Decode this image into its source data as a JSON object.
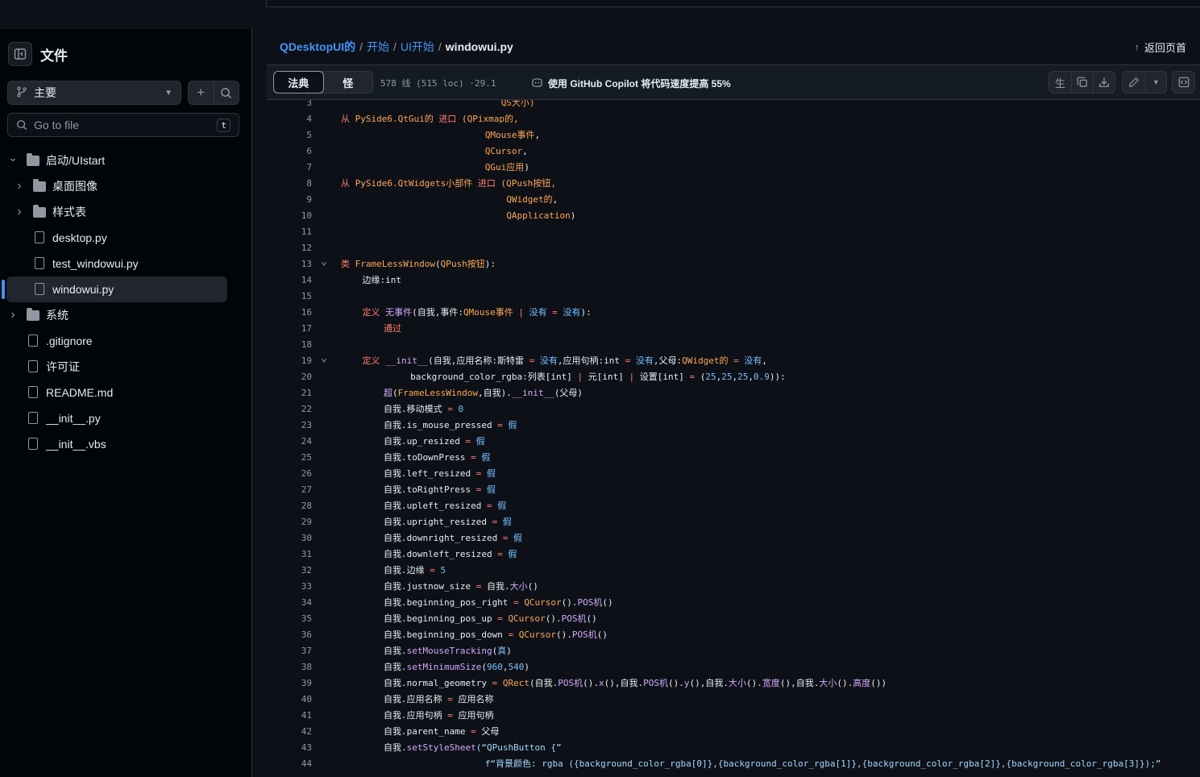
{
  "colors": {
    "link": "#4493f8",
    "keyword": "#ff7b72",
    "builtin": "#79c0ff",
    "func": "#d2a8ff",
    "class": "#ffa657",
    "string": "#a5d6ff",
    "text": "#e6edf3",
    "muted": "#9198a1"
  },
  "sidebar": {
    "title": "文件",
    "branch": "主要",
    "goto_placeholder": "Go to file",
    "goto_shortcut": "t",
    "tree": [
      {
        "name": "启动/UIstart",
        "type": "folder",
        "expanded": true,
        "depth": 0
      },
      {
        "name": "桌面图像",
        "type": "folder",
        "expanded": false,
        "depth": 1
      },
      {
        "name": "样式表",
        "type": "folder",
        "expanded": false,
        "depth": 1
      },
      {
        "name": "desktop.py",
        "type": "file",
        "depth": 1
      },
      {
        "name": "test_windowui.py",
        "type": "file",
        "depth": 1
      },
      {
        "name": "windowui.py",
        "type": "file",
        "depth": 1,
        "selected": true
      },
      {
        "name": "系统",
        "type": "folder",
        "expanded": false,
        "depth": 0
      },
      {
        "name": ".gitignore",
        "type": "file",
        "depth": 0
      },
      {
        "name": "许可证",
        "type": "file",
        "depth": 0
      },
      {
        "name": "README.md",
        "type": "file",
        "depth": 0
      },
      {
        "name": "__init__.py",
        "type": "file",
        "depth": 0
      },
      {
        "name": "__init__.vbs",
        "type": "file",
        "depth": 0
      }
    ]
  },
  "breadcrumb": {
    "links": [
      "QDesktopUI的",
      "开始",
      "UI开始"
    ],
    "current": "windowui.py"
  },
  "back_to_top": "返回页首",
  "file_header": {
    "tabs": [
      {
        "label": "法典",
        "active": true
      },
      {
        "label": "怪",
        "active": false
      }
    ],
    "meta": "578 线  (515 loc) ·29.1",
    "copilot": "使用 GitHub Copilot 将代码速度提高 55%",
    "raw_label": "生"
  },
  "code": {
    "lines": [
      {
        "n": 3,
        "t": [
          [
            "                              ",
            ""
          ],
          [
            "QS大小)",
            "class"
          ]
        ]
      },
      {
        "n": 4,
        "t": [
          [
            "从 ",
            "keyword"
          ],
          [
            "PySide6.QtGui的 ",
            "class"
          ],
          [
            "进口 ",
            "keyword"
          ],
          [
            "(QPixmap的,",
            "class"
          ]
        ]
      },
      {
        "n": 5,
        "t": [
          [
            "                           ",
            ""
          ],
          [
            "QMouse事件",
            "class"
          ],
          [
            ",",
            ""
          ]
        ]
      },
      {
        "n": 6,
        "t": [
          [
            "                           ",
            ""
          ],
          [
            "QCursor",
            "class"
          ],
          [
            ",",
            ""
          ]
        ]
      },
      {
        "n": 7,
        "t": [
          [
            "                           ",
            ""
          ],
          [
            "QGui应用",
            "class"
          ],
          [
            ")",
            ""
          ]
        ]
      },
      {
        "n": 8,
        "t": [
          [
            "从 ",
            "keyword"
          ],
          [
            "PySide6.QtWidgets小部件 ",
            "class"
          ],
          [
            "进口 ",
            "keyword"
          ],
          [
            "(QPush按钮,",
            "class"
          ]
        ]
      },
      {
        "n": 9,
        "t": [
          [
            "                               ",
            ""
          ],
          [
            "QWidget的",
            "class"
          ],
          [
            ",",
            ""
          ]
        ]
      },
      {
        "n": 10,
        "t": [
          [
            "                               ",
            ""
          ],
          [
            "QApplication",
            "class"
          ],
          [
            ")",
            ""
          ]
        ]
      },
      {
        "n": 11,
        "t": []
      },
      {
        "n": 12,
        "t": []
      },
      {
        "n": 13,
        "fold": true,
        "t": [
          [
            "类 ",
            "keyword"
          ],
          [
            "FrameLessWindow",
            "class"
          ],
          [
            "(",
            ""
          ],
          [
            "QPush按钮",
            "class"
          ],
          [
            "):",
            ""
          ]
        ]
      },
      {
        "n": 14,
        "t": [
          [
            "    边缘:int",
            ""
          ]
        ]
      },
      {
        "n": 15,
        "t": []
      },
      {
        "n": 16,
        "t": [
          [
            "    ",
            ""
          ],
          [
            "定义 ",
            "keyword"
          ],
          [
            "无事件",
            "func"
          ],
          [
            "(自我,事件:",
            ""
          ],
          [
            "QMouse事件",
            "class"
          ],
          [
            " | ",
            "keyword"
          ],
          [
            "没有",
            "builtin"
          ],
          [
            " = ",
            "keyword"
          ],
          [
            "没有",
            "builtin"
          ],
          [
            "):",
            ""
          ]
        ]
      },
      {
        "n": 17,
        "t": [
          [
            "        ",
            ""
          ],
          [
            "通过",
            "keyword"
          ]
        ]
      },
      {
        "n": 18,
        "t": []
      },
      {
        "n": 19,
        "fold": true,
        "t": [
          [
            "    ",
            ""
          ],
          [
            "定义 ",
            "keyword"
          ],
          [
            "__init__",
            "func"
          ],
          [
            "(自我,应用名称:斯特雷 ",
            ""
          ],
          [
            "=",
            "keyword"
          ],
          [
            " 没有",
            "builtin"
          ],
          [
            ",应用句柄:int ",
            ""
          ],
          [
            "=",
            "keyword"
          ],
          [
            " 没有",
            "builtin"
          ],
          [
            ",父母:",
            ""
          ],
          [
            "QWidget的",
            "class"
          ],
          [
            " = ",
            "keyword"
          ],
          [
            "没有",
            "builtin"
          ],
          [
            ",",
            ""
          ]
        ]
      },
      {
        "n": 20,
        "t": [
          [
            "             background_color_rgba:列表[int] ",
            ""
          ],
          [
            "|",
            "keyword"
          ],
          [
            " 元[int] ",
            ""
          ],
          [
            "|",
            "keyword"
          ],
          [
            " 设置[int] ",
            ""
          ],
          [
            "=",
            "keyword"
          ],
          [
            " (",
            ""
          ],
          [
            "25",
            "builtin"
          ],
          [
            ",",
            ""
          ],
          [
            "25",
            "builtin"
          ],
          [
            ",",
            ""
          ],
          [
            "25",
            "builtin"
          ],
          [
            ",",
            ""
          ],
          [
            "0.9",
            "builtin"
          ],
          [
            ")):",
            ""
          ]
        ]
      },
      {
        "n": 21,
        "t": [
          [
            "        ",
            ""
          ],
          [
            "超",
            "func"
          ],
          [
            "(",
            ""
          ],
          [
            "FrameLessWindow",
            "class"
          ],
          [
            ",自我).",
            ""
          ],
          [
            "__init__",
            "func"
          ],
          [
            "(父母)",
            ""
          ]
        ]
      },
      {
        "n": 22,
        "t": [
          [
            "        自我.移动模式 ",
            ""
          ],
          [
            "=",
            "keyword"
          ],
          [
            " 0",
            "builtin"
          ]
        ]
      },
      {
        "n": 23,
        "t": [
          [
            "        自我.is_mouse_pressed ",
            ""
          ],
          [
            "=",
            "keyword"
          ],
          [
            " 假",
            "builtin"
          ]
        ]
      },
      {
        "n": 24,
        "t": [
          [
            "        自我.up_resized ",
            ""
          ],
          [
            "=",
            "keyword"
          ],
          [
            " 假",
            "builtin"
          ]
        ]
      },
      {
        "n": 25,
        "t": [
          [
            "        自我.toDownPress ",
            ""
          ],
          [
            "=",
            "keyword"
          ],
          [
            " 假",
            "builtin"
          ]
        ]
      },
      {
        "n": 26,
        "t": [
          [
            "        自我.left_resized ",
            ""
          ],
          [
            "=",
            "keyword"
          ],
          [
            " 假",
            "builtin"
          ]
        ]
      },
      {
        "n": 27,
        "t": [
          [
            "        自我.toRightPress ",
            ""
          ],
          [
            "=",
            "keyword"
          ],
          [
            " 假",
            "builtin"
          ]
        ]
      },
      {
        "n": 28,
        "t": [
          [
            "        自我.upleft_resized ",
            ""
          ],
          [
            "=",
            "keyword"
          ],
          [
            " 假",
            "builtin"
          ]
        ]
      },
      {
        "n": 29,
        "t": [
          [
            "        自我.upright_resized ",
            ""
          ],
          [
            "=",
            "keyword"
          ],
          [
            " 假",
            "builtin"
          ]
        ]
      },
      {
        "n": 30,
        "t": [
          [
            "        自我.downright_resized ",
            ""
          ],
          [
            "=",
            "keyword"
          ],
          [
            " 假",
            "builtin"
          ]
        ]
      },
      {
        "n": 31,
        "t": [
          [
            "        自我.downleft_resized ",
            ""
          ],
          [
            "=",
            "keyword"
          ],
          [
            " 假",
            "builtin"
          ]
        ]
      },
      {
        "n": 32,
        "t": [
          [
            "        自我.边缘 ",
            ""
          ],
          [
            "=",
            "keyword"
          ],
          [
            " 5",
            "builtin"
          ]
        ]
      },
      {
        "n": 33,
        "t": [
          [
            "        自我.justnow_size ",
            ""
          ],
          [
            "=",
            "keyword"
          ],
          [
            " 自我.",
            ""
          ],
          [
            "大小",
            "func"
          ],
          [
            "()",
            ""
          ]
        ]
      },
      {
        "n": 34,
        "t": [
          [
            "        自我.beginning_pos_right ",
            ""
          ],
          [
            "=",
            "keyword"
          ],
          [
            " ",
            ""
          ],
          [
            "QCursor",
            "class"
          ],
          [
            "().",
            ""
          ],
          [
            "POS机",
            "func"
          ],
          [
            "()",
            ""
          ]
        ]
      },
      {
        "n": 35,
        "t": [
          [
            "        自我.beginning_pos_up ",
            ""
          ],
          [
            "=",
            "keyword"
          ],
          [
            " ",
            ""
          ],
          [
            "QCursor",
            "class"
          ],
          [
            "().",
            ""
          ],
          [
            "POS机",
            "func"
          ],
          [
            "()",
            ""
          ]
        ]
      },
      {
        "n": 36,
        "t": [
          [
            "        自我.beginning_pos_down ",
            ""
          ],
          [
            "=",
            "keyword"
          ],
          [
            " ",
            ""
          ],
          [
            "QCursor",
            "class"
          ],
          [
            "().",
            ""
          ],
          [
            "POS机",
            "func"
          ],
          [
            "()",
            ""
          ]
        ]
      },
      {
        "n": 37,
        "t": [
          [
            "        自我.",
            ""
          ],
          [
            "setMouseTracking",
            "func"
          ],
          [
            "(",
            ""
          ],
          [
            "真",
            "builtin"
          ],
          [
            ")",
            ""
          ]
        ]
      },
      {
        "n": 38,
        "t": [
          [
            "        自我.",
            ""
          ],
          [
            "setMinimumSize",
            "func"
          ],
          [
            "(",
            ""
          ],
          [
            "960",
            "builtin"
          ],
          [
            ",",
            ""
          ],
          [
            "540",
            "builtin"
          ],
          [
            ")",
            ""
          ]
        ]
      },
      {
        "n": 39,
        "t": [
          [
            "        自我.normal_geometry ",
            ""
          ],
          [
            "=",
            "keyword"
          ],
          [
            " ",
            ""
          ],
          [
            "QRect",
            "class"
          ],
          [
            "(自我.",
            ""
          ],
          [
            "POS机",
            "func"
          ],
          [
            "().",
            ""
          ],
          [
            "x",
            "func"
          ],
          [
            "(),自我.",
            ""
          ],
          [
            "POS机",
            "func"
          ],
          [
            "().",
            ""
          ],
          [
            "y",
            "func"
          ],
          [
            "(),自我.",
            ""
          ],
          [
            "大小",
            "func"
          ],
          [
            "().",
            ""
          ],
          [
            "宽度",
            "func"
          ],
          [
            "(),自我.",
            ""
          ],
          [
            "大小",
            "func"
          ],
          [
            "().",
            ""
          ],
          [
            "高度",
            "func"
          ],
          [
            "())",
            ""
          ]
        ]
      },
      {
        "n": 40,
        "t": [
          [
            "        自我.应用名称 ",
            ""
          ],
          [
            "=",
            "keyword"
          ],
          [
            " 应用名称",
            ""
          ]
        ]
      },
      {
        "n": 41,
        "t": [
          [
            "        自我.应用句柄 ",
            ""
          ],
          [
            "=",
            "keyword"
          ],
          [
            " 应用句柄",
            ""
          ]
        ]
      },
      {
        "n": 42,
        "t": [
          [
            "        自我.parent_name ",
            ""
          ],
          [
            "=",
            "keyword"
          ],
          [
            " 父母",
            ""
          ]
        ]
      },
      {
        "n": 43,
        "t": [
          [
            "        自我.",
            ""
          ],
          [
            "setStyleSheet",
            "func"
          ],
          [
            "(“QPushButton {”",
            "string"
          ]
        ]
      },
      {
        "n": 44,
        "t": [
          [
            "                           ",
            ""
          ],
          [
            "f“背景颜色: rgba ({background_color_rgba[0]},{background_color_rgba[1]},{background_color_rgba[2]},{background_color_rgba[3]});”",
            "string"
          ]
        ]
      }
    ]
  }
}
